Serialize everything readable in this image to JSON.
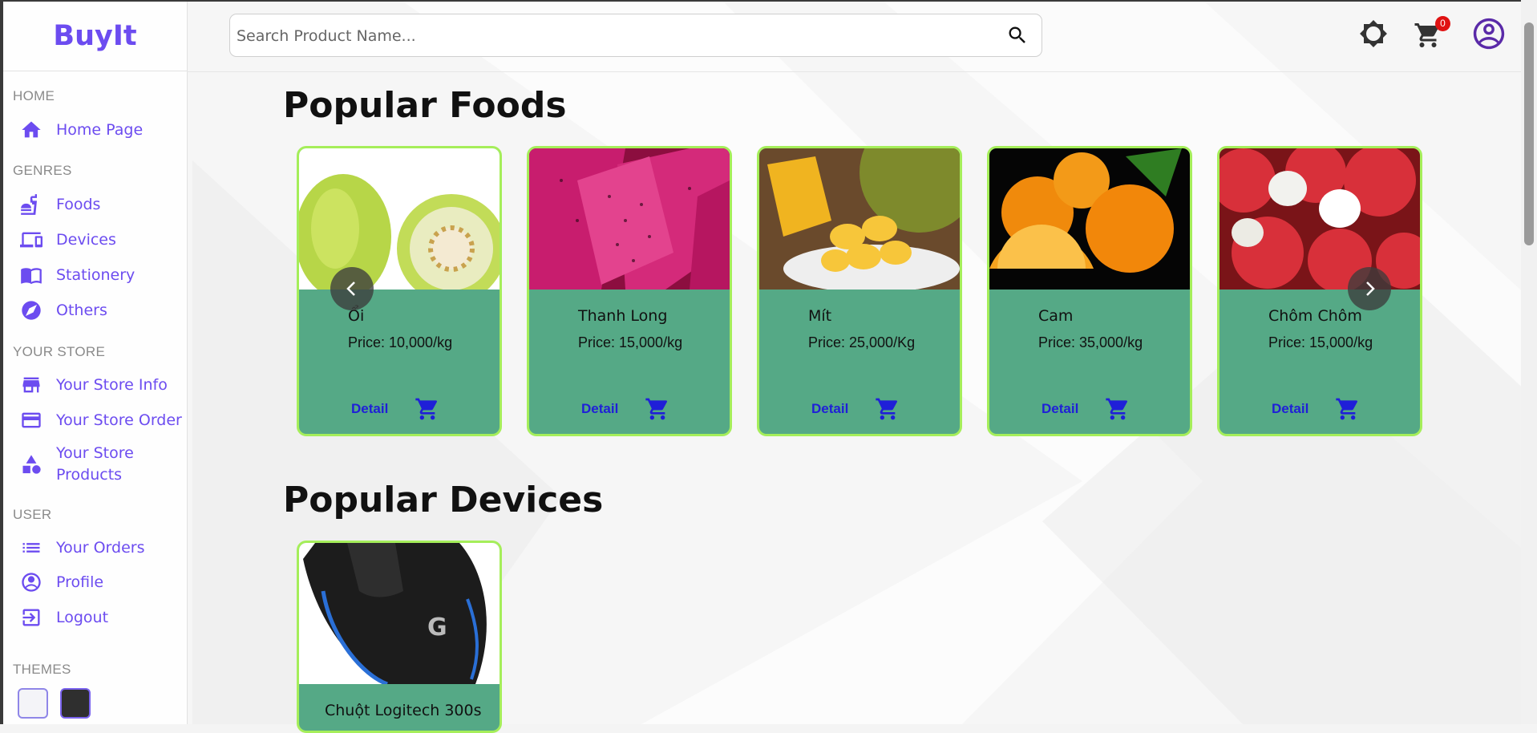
{
  "app": {
    "logo": "BuyIt"
  },
  "search": {
    "placeholder": "Search Product Name..."
  },
  "header": {
    "cart_count": "0"
  },
  "sidebar": {
    "sections": [
      {
        "title": "HOME",
        "items": [
          {
            "label": "Home Page",
            "icon": "home-icon"
          }
        ]
      },
      {
        "title": "GENRES",
        "items": [
          {
            "label": "Foods",
            "icon": "fastfood-icon"
          },
          {
            "label": "Devices",
            "icon": "devices-icon"
          },
          {
            "label": "Stationery",
            "icon": "book-icon"
          },
          {
            "label": "Others",
            "icon": "compass-icon"
          }
        ]
      },
      {
        "title": "YOUR STORE",
        "items": [
          {
            "label": "Your Store Info",
            "icon": "store-icon"
          },
          {
            "label": "Your Store Order",
            "icon": "credit-card-icon"
          },
          {
            "label": "Your Store Products",
            "icon": "shapes-icon"
          }
        ]
      },
      {
        "title": "USER",
        "items": [
          {
            "label": "Your Orders",
            "icon": "list-icon"
          },
          {
            "label": "Profile",
            "icon": "account-circle-icon"
          },
          {
            "label": "Logout",
            "icon": "logout-icon"
          }
        ]
      },
      {
        "title": "THEMES",
        "items": []
      }
    ],
    "themes": [
      {
        "color": "#f4f4f8"
      },
      {
        "color": "#2f2f2f"
      }
    ]
  },
  "foods": {
    "title": "Popular Foods",
    "products": [
      {
        "name": "Ổi",
        "price": "Price: 10,000/kg",
        "detail": "Detail",
        "image": "guava"
      },
      {
        "name": "Thanh Long",
        "price": "Price: 15,000/kg",
        "detail": "Detail",
        "image": "dragon-fruit"
      },
      {
        "name": "Mít",
        "price": "Price: 25,000/Kg",
        "detail": "Detail",
        "image": "jackfruit"
      },
      {
        "name": "Cam",
        "price": "Price: 35,000/kg",
        "detail": "Detail",
        "image": "orange"
      },
      {
        "name": "Chôm Chôm",
        "price": "Price: 15,000/kg",
        "detail": "Detail",
        "image": "rambutan"
      }
    ]
  },
  "devices": {
    "title": "Popular Devices",
    "products": [
      {
        "name": "Chuột Logitech 300s",
        "image": "mouse"
      }
    ]
  },
  "colors": {
    "accent": "#6c4cf0",
    "card_bg": "#55a986",
    "card_border": "#a5ee5a",
    "link": "#1f1fd8",
    "badge": "#e01212"
  }
}
